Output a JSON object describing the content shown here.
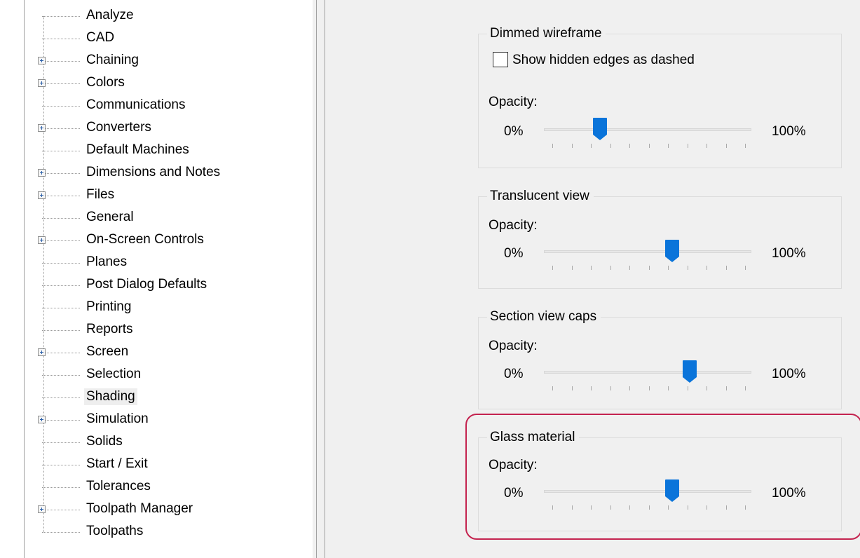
{
  "tree": {
    "items": [
      {
        "label": "Analyze",
        "expandable": false
      },
      {
        "label": "CAD",
        "expandable": false
      },
      {
        "label": "Chaining",
        "expandable": true
      },
      {
        "label": "Colors",
        "expandable": true
      },
      {
        "label": "Communications",
        "expandable": false
      },
      {
        "label": "Converters",
        "expandable": true
      },
      {
        "label": "Default Machines",
        "expandable": false
      },
      {
        "label": "Dimensions and Notes",
        "expandable": true
      },
      {
        "label": "Files",
        "expandable": true
      },
      {
        "label": "General",
        "expandable": false
      },
      {
        "label": "On-Screen Controls",
        "expandable": true
      },
      {
        "label": "Planes",
        "expandable": false
      },
      {
        "label": "Post Dialog Defaults",
        "expandable": false
      },
      {
        "label": "Printing",
        "expandable": false
      },
      {
        "label": "Reports",
        "expandable": false
      },
      {
        "label": "Screen",
        "expandable": true
      },
      {
        "label": "Selection",
        "expandable": false
      },
      {
        "label": "Shading",
        "expandable": false,
        "selected": true
      },
      {
        "label": "Simulation",
        "expandable": true
      },
      {
        "label": "Solids",
        "expandable": false
      },
      {
        "label": "Start / Exit",
        "expandable": false
      },
      {
        "label": "Tolerances",
        "expandable": false
      },
      {
        "label": "Toolpath Manager",
        "expandable": true
      },
      {
        "label": "Toolpaths",
        "expandable": false
      }
    ]
  },
  "groups": [
    {
      "title": "Dimmed wireframe",
      "checkbox": {
        "label": "Show hidden edges as dashed",
        "checked": false
      },
      "opacity_label": "Opacity:",
      "min_label": "0%",
      "max_label": "100%",
      "opacity_fraction": 0.25
    },
    {
      "title": "Translucent view",
      "opacity_label": "Opacity:",
      "min_label": "0%",
      "max_label": "100%",
      "opacity_fraction": 0.63
    },
    {
      "title": "Section view caps",
      "opacity_label": "Opacity:",
      "min_label": "0%",
      "max_label": "100%",
      "opacity_fraction": 0.72
    },
    {
      "title": "Glass material",
      "opacity_label": "Opacity:",
      "min_label": "0%",
      "max_label": "100%",
      "opacity_fraction": 0.63,
      "highlighted": true
    }
  ],
  "colors": {
    "thumb": "#0a74da",
    "highlight": "#c4234f",
    "panel_bg": "#f0f0f0"
  }
}
